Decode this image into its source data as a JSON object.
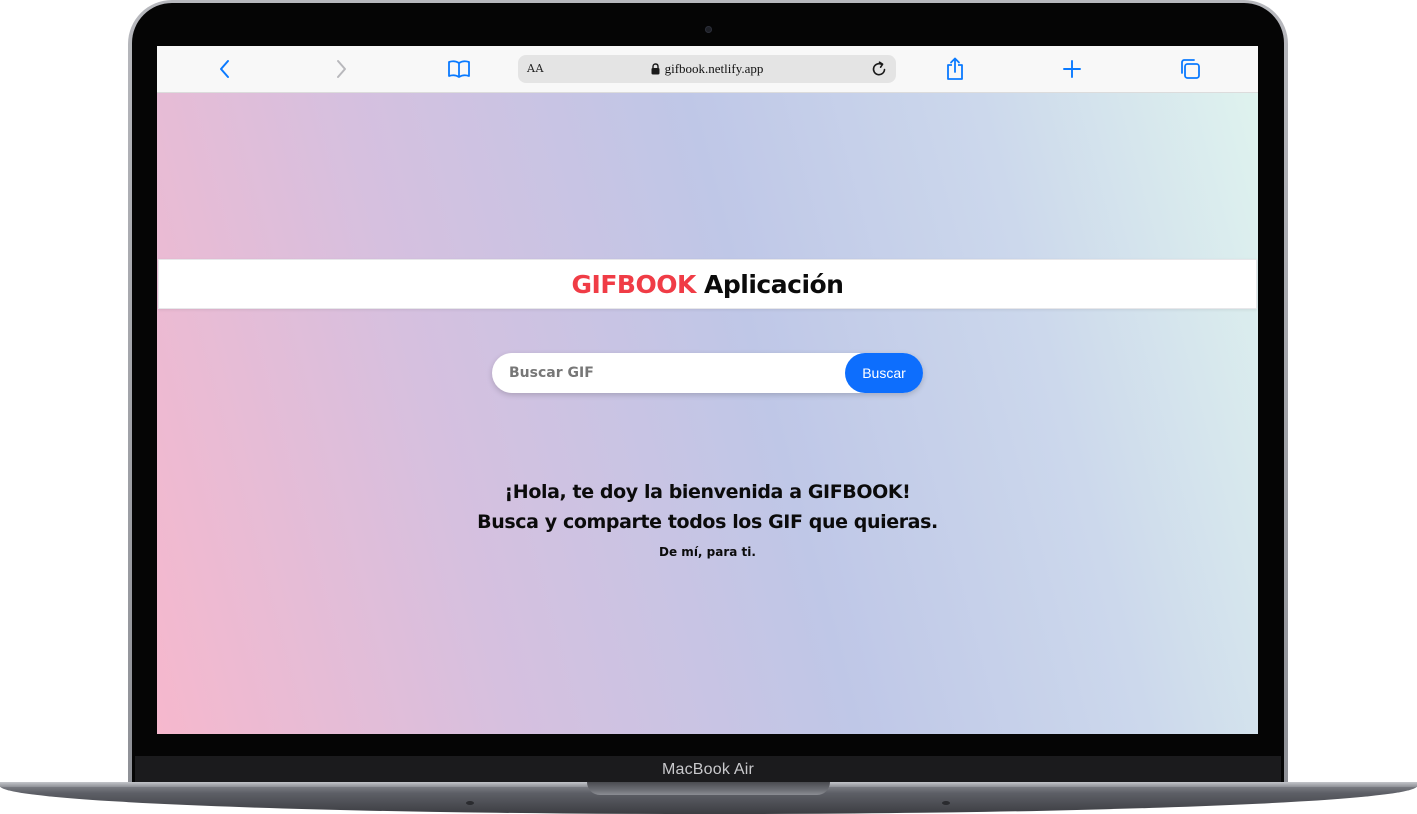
{
  "device": {
    "model_label": "MacBook Air"
  },
  "browser": {
    "text_size_label": "AA",
    "url": "gifbook.netlify.app",
    "icons": {
      "back": "chevron-left-icon",
      "forward": "chevron-right-icon",
      "bookmarks": "book-icon",
      "lock": "lock-icon",
      "reload": "reload-icon",
      "share": "share-icon",
      "new_tab": "plus-icon",
      "tabs": "tabs-icon"
    },
    "accent_color": "#0a7aff"
  },
  "app": {
    "brand": "GIFBOOK",
    "title_rest": " Aplicación",
    "brand_color": "#f03c46"
  },
  "search": {
    "placeholder": "Buscar GIF",
    "value": "",
    "button_label": "Buscar",
    "button_color": "#0d6efd"
  },
  "welcome": {
    "line1": "¡Hola, te doy la bienvenida a GIFBOOK!",
    "line2": "Busca y comparte todos los GIF que quieras.",
    "tagline": "De mí, para ti."
  }
}
